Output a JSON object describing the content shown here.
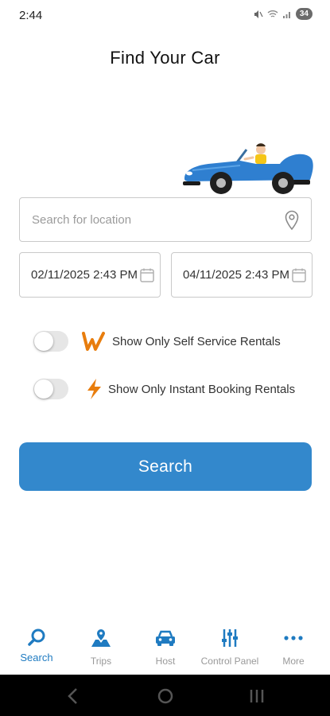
{
  "status_bar": {
    "time": "2:44",
    "battery": "34"
  },
  "page": {
    "title": "Find Your Car"
  },
  "search_form": {
    "location_placeholder": "Search for location",
    "start_date": "02/11/2025 2:43 PM",
    "end_date": "04/11/2025 2:43 PM",
    "self_service_label": "Show Only Self Service Rentals",
    "self_service_on": false,
    "instant_booking_label": "Show Only Instant Booking Rentals",
    "instant_booking_on": false,
    "search_button": "Search"
  },
  "bottom_nav": {
    "items": [
      {
        "label": "Search",
        "icon": "search-icon",
        "active": true
      },
      {
        "label": "Trips",
        "icon": "map-icon",
        "active": false
      },
      {
        "label": "Host",
        "icon": "car-icon",
        "active": false
      },
      {
        "label": "Control Panel",
        "icon": "sliders-icon",
        "active": false
      },
      {
        "label": "More",
        "icon": "more-dots-icon",
        "active": false
      }
    ]
  },
  "colors": {
    "primary": "#3388cc",
    "active_nav": "#1f7bc1",
    "accent_orange": "#e87d0d",
    "inactive_nav": "#999999",
    "car_blue": "#2f7fd0"
  }
}
